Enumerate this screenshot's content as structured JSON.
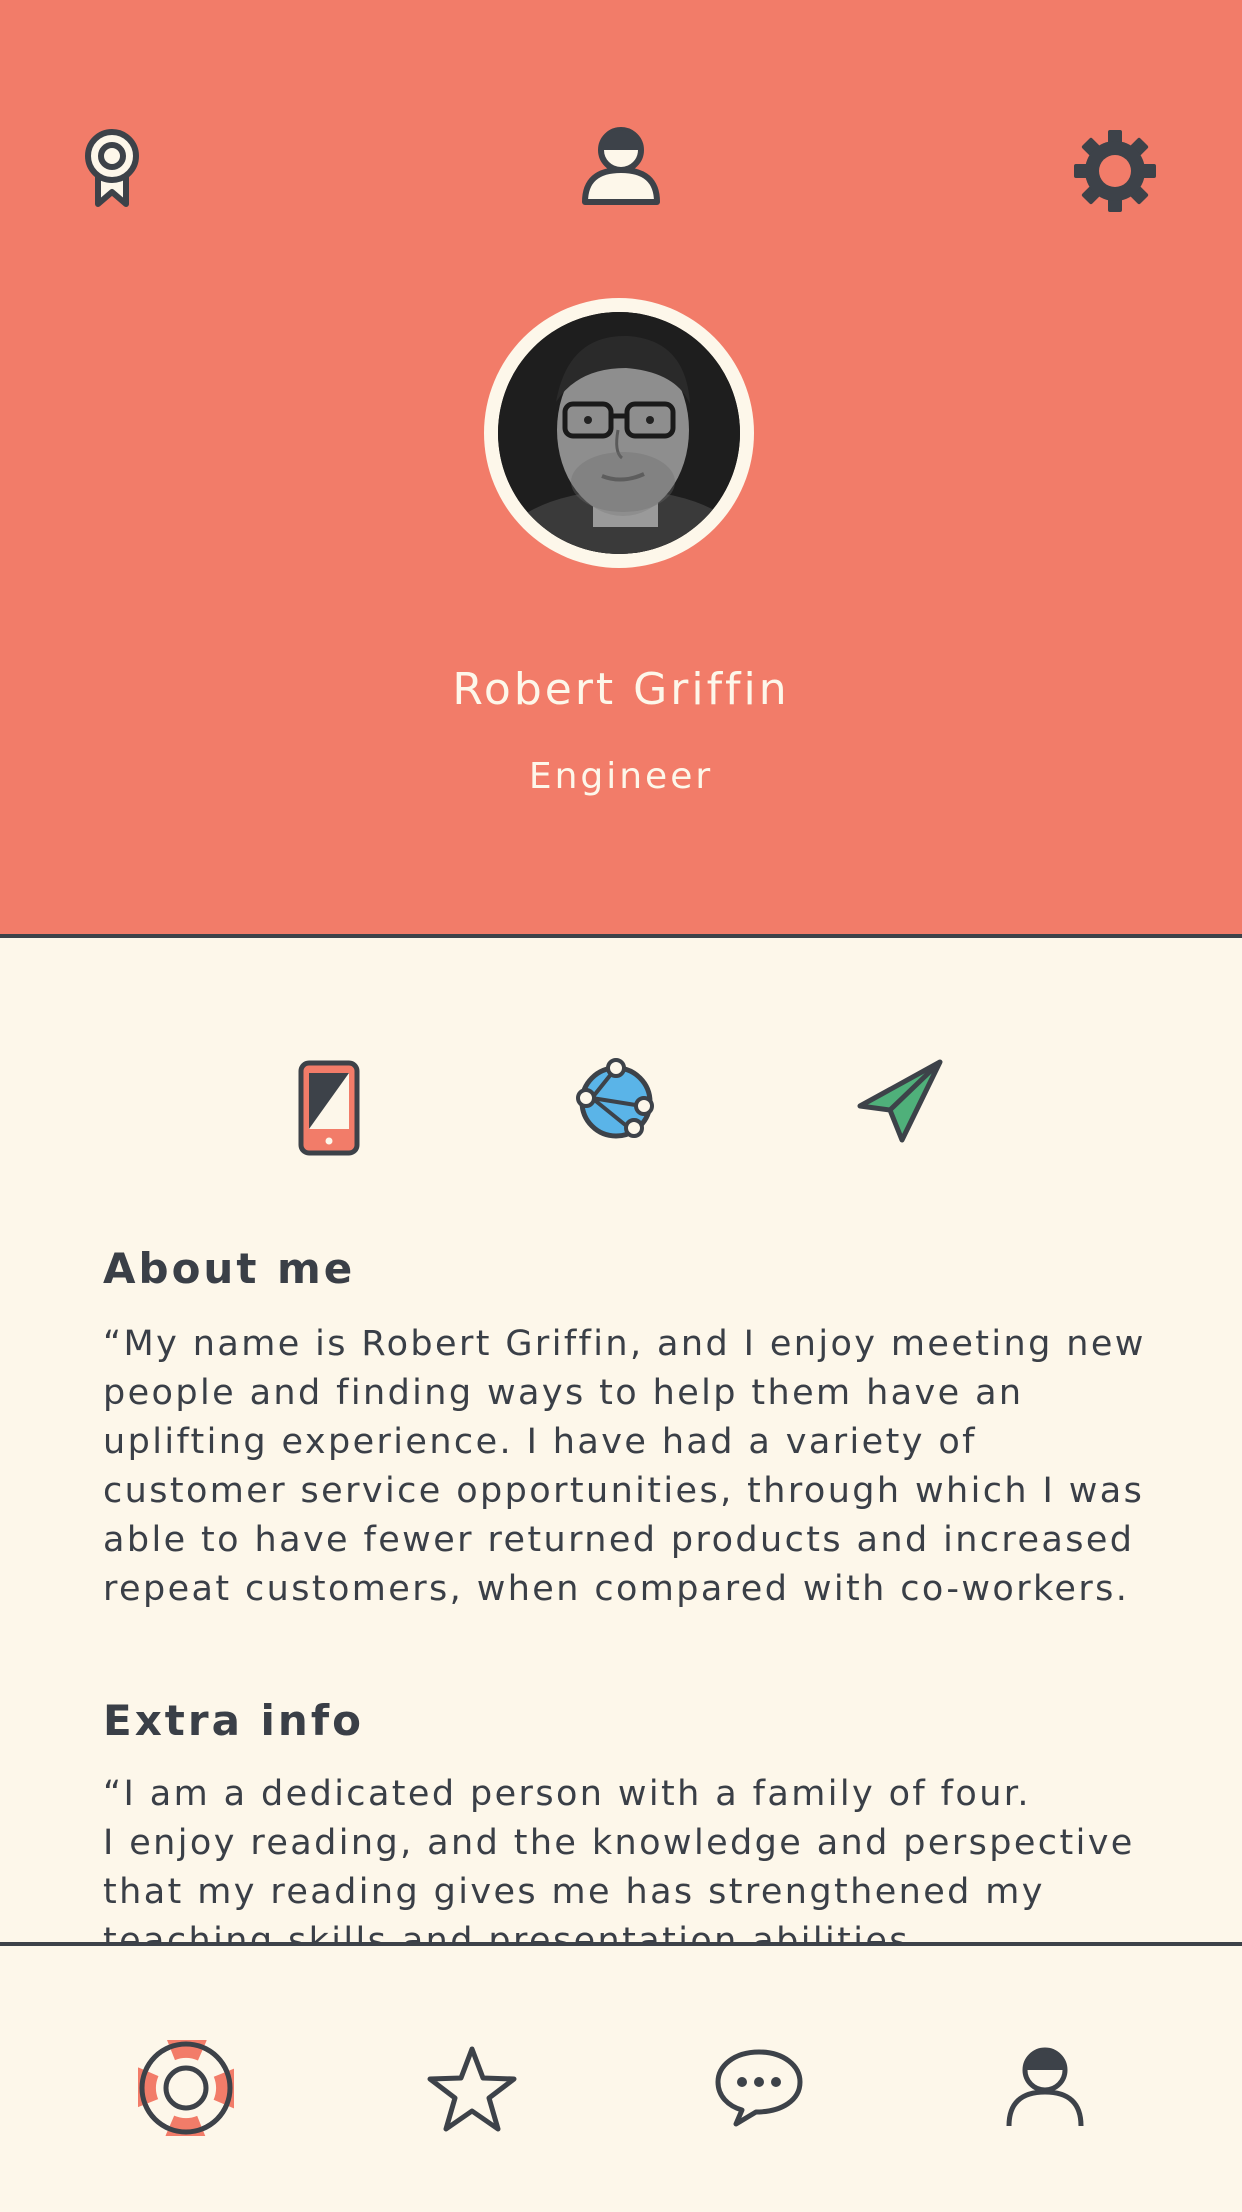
{
  "header": {
    "left_icon": "award-ribbon-icon",
    "center_icon": "user-icon",
    "right_icon": "settings-gear-icon",
    "accent_color": "#f27c69"
  },
  "profile": {
    "name": "Robert Griffin",
    "role": "Engineer",
    "avatar": "profile-photo"
  },
  "contact": {
    "icons": [
      "phone-icon",
      "network-globe-icon",
      "send-paper-plane-icon"
    ]
  },
  "about": {
    "title": "About me",
    "text": "“My name is Robert Griffin, and I enjoy meeting new\npeople and finding ways to help them have an\nuplifting experience. I have had a variety of\ncustomer service opportunities, through which I was\nable to have fewer returned products and increased\nrepeat customers, when compared with co-workers."
  },
  "extra": {
    "title": "Extra info",
    "text": "“I am a dedicated person with a family of four.\nI enjoy reading, and the knowledge and perspective\nthat my reading gives me has strengthened my\nteaching skills and presentation abilities."
  },
  "tab_bar": {
    "items": [
      "lifebuoy-help-icon",
      "star-favorites-icon",
      "chat-bubble-icon",
      "profile-user-icon"
    ],
    "active": "lifebuoy-help-icon"
  }
}
